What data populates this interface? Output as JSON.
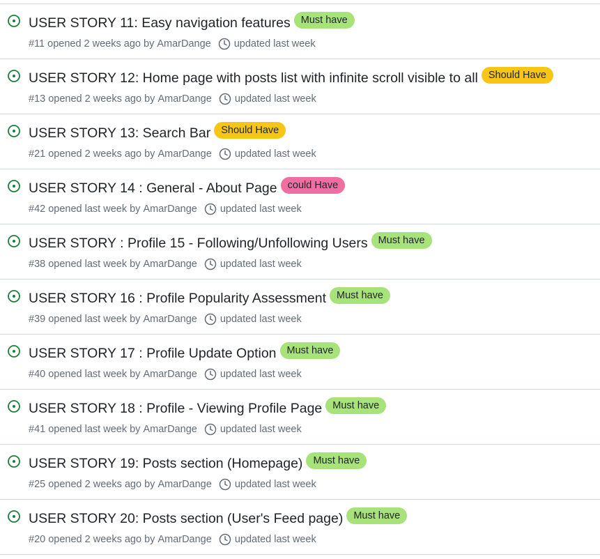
{
  "colors": {
    "open_icon": "#1a7f37",
    "border": "#d0d7de",
    "title": "#1f2328",
    "meta": "#636c76",
    "must_have": "#a8e27a",
    "should_have": "#f7c615",
    "could_have": "#ef6fa3"
  },
  "icons": {
    "status": "issue-opened-icon",
    "updated": "clock-icon"
  },
  "issues": [
    {
      "title": "USER STORY 11: Easy navigation features",
      "label": "Must have",
      "label_color": "#a8e27a",
      "meta": "#11 opened 2 weeks ago by",
      "author": "AmarDange",
      "updated": "updated last week"
    },
    {
      "title": "USER STORY 12: Home page with posts list with infinite scroll visible to all",
      "label": "Should Have",
      "label_color": "#f7c615",
      "meta": "#13 opened 2 weeks ago by",
      "author": "AmarDange",
      "updated": "updated last week"
    },
    {
      "title": "USER STORY 13: Search Bar",
      "label": "Should Have",
      "label_color": "#f7c615",
      "meta": "#21 opened 2 weeks ago by",
      "author": "AmarDange",
      "updated": "updated last week"
    },
    {
      "title": "USER STORY 14 : General - About Page",
      "label": "could Have",
      "label_color": "#ef6fa3",
      "meta": "#42 opened last week by",
      "author": "AmarDange",
      "updated": "updated last week"
    },
    {
      "title": "USER STORY : Profile 15 - Following/Unfollowing Users",
      "label": "Must have",
      "label_color": "#a8e27a",
      "meta": "#38 opened last week by",
      "author": "AmarDange",
      "updated": "updated last week"
    },
    {
      "title": "USER STORY 16 : Profile Popularity Assessment",
      "label": "Must have",
      "label_color": "#a8e27a",
      "meta": "#39 opened last week by",
      "author": "AmarDange",
      "updated": "updated last week"
    },
    {
      "title": "USER STORY 17 : Profile Update Option",
      "label": "Must have",
      "label_color": "#a8e27a",
      "meta": "#40 opened last week by",
      "author": "AmarDange",
      "updated": "updated last week"
    },
    {
      "title": "USER STORY 18 : Profile - Viewing Profile Page",
      "label": "Must have",
      "label_color": "#a8e27a",
      "meta": "#41 opened last week by",
      "author": "AmarDange",
      "updated": "updated last week"
    },
    {
      "title": "USER STORY 19: Posts section (Homepage)",
      "label": "Must have",
      "label_color": "#a8e27a",
      "meta": "#25 opened 2 weeks ago by",
      "author": "AmarDange",
      "updated": "updated last week"
    },
    {
      "title": "USER STORY 20: Posts section (User's Feed page)",
      "label": "Must have",
      "label_color": "#a8e27a",
      "meta": "#20 opened 2 weeks ago by",
      "author": "AmarDange",
      "updated": "updated last week"
    }
  ]
}
